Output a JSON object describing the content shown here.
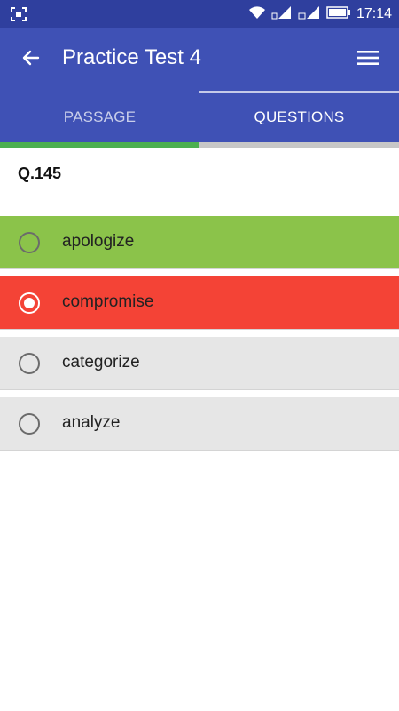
{
  "status_bar": {
    "time": "17:14",
    "icons": [
      "screenshot-icon",
      "wifi-icon",
      "signal-g-icon",
      "signal-3g-icon",
      "battery-icon"
    ]
  },
  "app_bar": {
    "title": "Practice Test 4",
    "back_icon": "arrow-left-icon",
    "menu_icon": "menu-icon"
  },
  "tabs": [
    {
      "label": "PASSAGE",
      "selected": false
    },
    {
      "label": "QUESTIONS",
      "selected": true
    }
  ],
  "progress": {
    "fraction": 0.5,
    "fill_color": "#4caf50"
  },
  "question": {
    "number": "Q.145"
  },
  "options": [
    {
      "label": "apologize",
      "state": "correct",
      "selected": false,
      "bg": "#8bc34a"
    },
    {
      "label": "compromise",
      "state": "wrong",
      "selected": true,
      "bg": "#f44336"
    },
    {
      "label": "categorize",
      "state": "neutral",
      "selected": false,
      "bg": "#e6e6e6"
    },
    {
      "label": "analyze",
      "state": "neutral",
      "selected": false,
      "bg": "#e6e6e6"
    }
  ],
  "colors": {
    "status_bar": "#2f3f9e",
    "primary": "#3f51b5",
    "tab_underline": "#c5cae9"
  }
}
